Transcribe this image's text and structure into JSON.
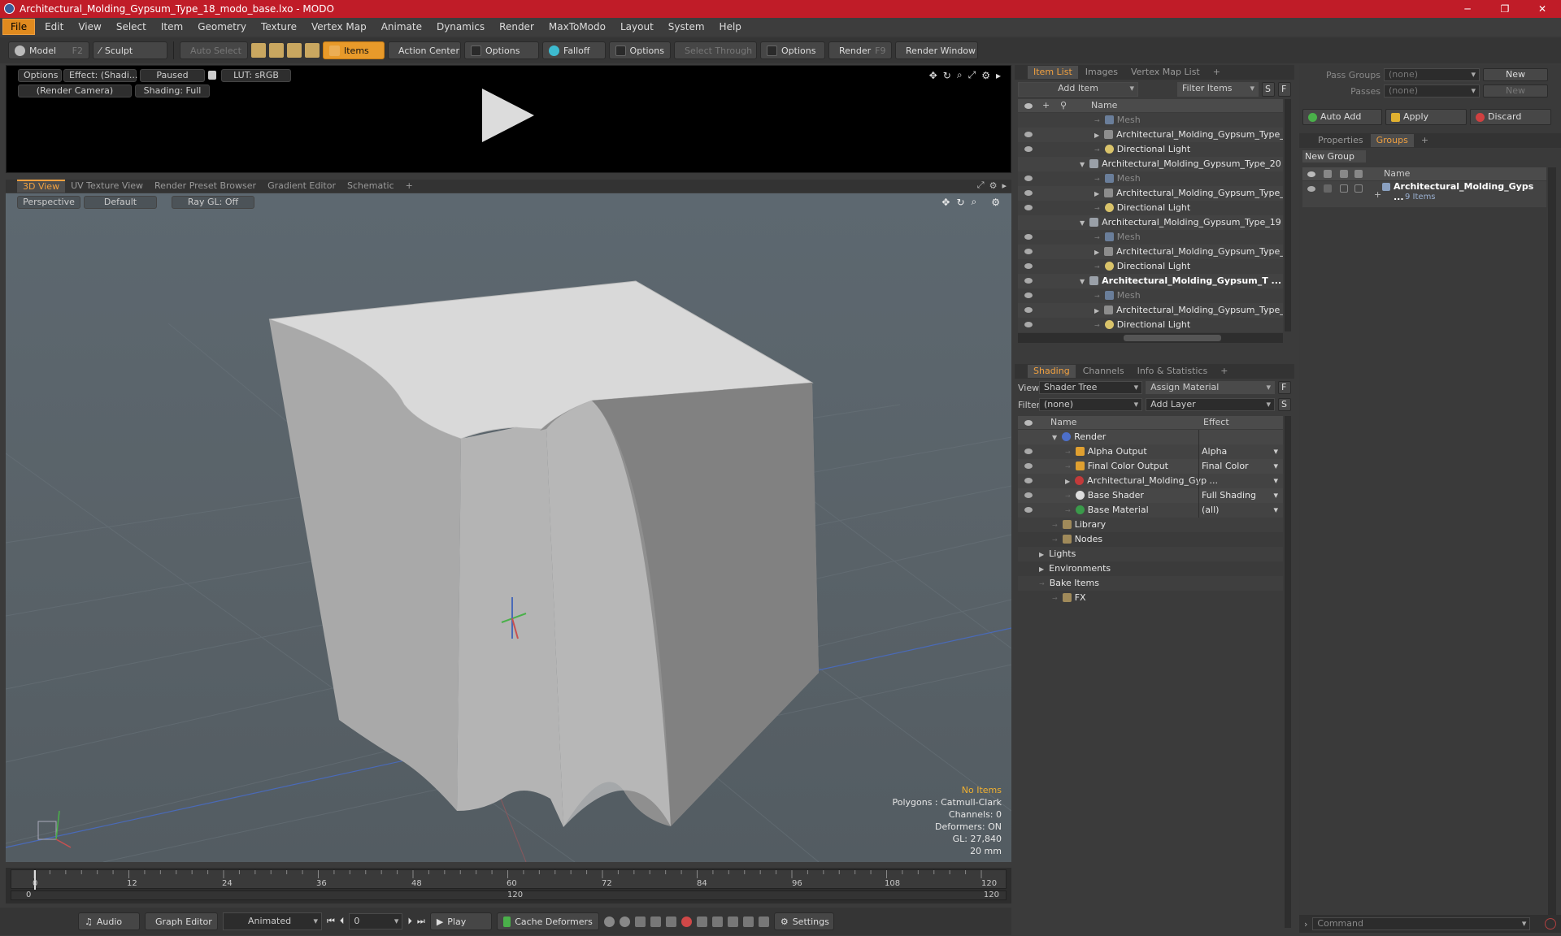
{
  "window": {
    "title": "Architectural_Molding_Gypsum_Type_18_modo_base.lxo - MODO",
    "min": "─",
    "max": "❐",
    "close": "✕"
  },
  "menu": [
    "File",
    "Edit",
    "View",
    "Select",
    "Item",
    "Geometry",
    "Texture",
    "Vertex Map",
    "Animate",
    "Dynamics",
    "Render",
    "MaxToModo",
    "Layout",
    "System",
    "Help"
  ],
  "toolbar": {
    "model": "Model",
    "model_key": "F2",
    "sculpt": "Sculpt",
    "auto_select": "Auto Select",
    "items": "Items",
    "action_center": "Action Center",
    "options1": "Options",
    "falloff": "Falloff",
    "options2": "Options",
    "select_through": "Select Through",
    "options3": "Options",
    "render": "Render",
    "render_key": "F9",
    "render_window": "Render Window"
  },
  "preview": {
    "options": "Options",
    "effect": "Effect: (Shadi...",
    "paused": "Paused",
    "lut": "LUT: sRGB",
    "camera": "(Render Camera)",
    "shading": "Shading: Full"
  },
  "view_tabs": [
    "3D View",
    "UV Texture View",
    "Render Preset Browser",
    "Gradient Editor",
    "Schematic",
    "+"
  ],
  "viewport": {
    "perspective": "Perspective",
    "default": "Default",
    "raygl": "Ray GL: Off",
    "hud": {
      "no_items": "No Items",
      "polygons": "Polygons : Catmull-Clark",
      "channels": "Channels: 0",
      "deformers": "Deformers: ON",
      "gl": "GL: 27,840",
      "unit": "20 mm"
    }
  },
  "timeline": {
    "ticks": [
      "0",
      "12",
      "24",
      "36",
      "48",
      "60",
      "72",
      "84",
      "96",
      "108",
      "120"
    ],
    "start": "0",
    "mid": "120",
    "end": "120"
  },
  "bottombar": {
    "audio": "Audio",
    "graph_editor": "Graph Editor",
    "animated": "Animated",
    "frame": "0",
    "play": "Play",
    "cache": "Cache Deformers",
    "settings": "Settings"
  },
  "itemlist": {
    "tabs": [
      "Item List",
      "Images",
      "Vertex Map List",
      "+"
    ],
    "add_item": "Add Item",
    "filter_items": "Filter Items",
    "s": "S",
    "f": "F",
    "name_col": "Name",
    "rows": [
      {
        "label": "Mesh",
        "indent": 3,
        "icon": "mesh",
        "style": "dim",
        "eye": false
      },
      {
        "label": "Architectural_Molding_Gypsum_Type_ ...",
        "indent": 3,
        "icon": "grp",
        "style": "",
        "eye": true,
        "arrow": "▶"
      },
      {
        "label": "Directional Light",
        "indent": 3,
        "icon": "light",
        "style": "",
        "eye": true
      },
      {
        "label": "Architectural_Molding_Gypsum_Type_20 ...",
        "indent": 2,
        "icon": "scene",
        "style": "",
        "eye": false,
        "arrow": "▼"
      },
      {
        "label": "Mesh",
        "indent": 3,
        "icon": "mesh",
        "style": "dim",
        "eye": true
      },
      {
        "label": "Architectural_Molding_Gypsum_Type_ ...",
        "indent": 3,
        "icon": "grp",
        "style": "",
        "eye": true,
        "arrow": "▶"
      },
      {
        "label": "Directional Light",
        "indent": 3,
        "icon": "light",
        "style": "",
        "eye": true
      },
      {
        "label": "Architectural_Molding_Gypsum_Type_19 ...",
        "indent": 2,
        "icon": "scene",
        "style": "",
        "eye": false,
        "arrow": "▼"
      },
      {
        "label": "Mesh",
        "indent": 3,
        "icon": "mesh",
        "style": "dim",
        "eye": true
      },
      {
        "label": "Architectural_Molding_Gypsum_Type_ ...",
        "indent": 3,
        "icon": "grp",
        "style": "",
        "eye": true,
        "arrow": "▶"
      },
      {
        "label": "Directional Light",
        "indent": 3,
        "icon": "light",
        "style": "",
        "eye": true
      },
      {
        "label": "Architectural_Molding_Gypsum_T ...",
        "indent": 2,
        "icon": "scene",
        "style": "bold",
        "eye": true,
        "arrow": "▼"
      },
      {
        "label": "Mesh",
        "indent": 3,
        "icon": "mesh",
        "style": "dim",
        "eye": true
      },
      {
        "label": "Architectural_Molding_Gypsum_Type_ ...",
        "indent": 3,
        "icon": "grp",
        "style": "",
        "eye": true,
        "arrow": "▶"
      },
      {
        "label": "Directional Light",
        "indent": 3,
        "icon": "light",
        "style": "",
        "eye": true
      }
    ]
  },
  "shading": {
    "tabs": [
      "Shading",
      "Channels",
      "Info & Statistics",
      "+"
    ],
    "view_label": "View",
    "view_value": "Shader Tree",
    "assign_material": "Assign Material",
    "f": "F",
    "filter_label": "Filter",
    "filter_value": "(none)",
    "add_layer": "Add Layer",
    "s": "S",
    "name_col": "Name",
    "effect_col": "Effect",
    "rows": [
      {
        "label": "Render",
        "indent": 1,
        "icon": "render",
        "effect": "",
        "eye": false,
        "arrow": "▼"
      },
      {
        "label": "Alpha Output",
        "indent": 2,
        "icon": "out",
        "effect": "Alpha",
        "eye": true
      },
      {
        "label": "Final Color Output",
        "indent": 2,
        "icon": "out",
        "effect": "Final Color",
        "eye": true
      },
      {
        "label": "Architectural_Molding_Gyp ...",
        "indent": 2,
        "icon": "mat",
        "effect": "",
        "eye": true,
        "arrow": "▶"
      },
      {
        "label": "Base Shader",
        "indent": 2,
        "icon": "shader",
        "effect": "Full Shading",
        "eye": true
      },
      {
        "label": "Base Material",
        "indent": 2,
        "icon": "basem",
        "effect": "(all)",
        "eye": true
      },
      {
        "label": "Library",
        "indent": 1,
        "icon": "fold",
        "effect": "",
        "eye": false
      },
      {
        "label": "Nodes",
        "indent": 1,
        "icon": "fold",
        "effect": "",
        "eye": false
      },
      {
        "label": "Lights",
        "indent": 0,
        "icon": "",
        "effect": "",
        "eye": false,
        "arrow": "▶"
      },
      {
        "label": "Environments",
        "indent": 0,
        "icon": "",
        "effect": "",
        "eye": false,
        "arrow": "▶"
      },
      {
        "label": "Bake Items",
        "indent": 0,
        "icon": "",
        "effect": "",
        "eye": false
      },
      {
        "label": "FX",
        "indent": 1,
        "icon": "fold",
        "effect": "",
        "eye": false
      }
    ]
  },
  "groups": {
    "pass_groups_label": "Pass Groups",
    "pass_groups_value": "(none)",
    "new1": "New",
    "passes_label": "Passes",
    "passes_value": "(none)",
    "new2": "New",
    "auto_add": "Auto Add",
    "apply": "Apply",
    "discard": "Discard",
    "tabs": [
      "Properties",
      "Groups",
      "+"
    ],
    "new_group": "New Group",
    "name_col": "Name",
    "item_name": "Architectural_Molding_Gyps ...",
    "item_count": "9 Items",
    "command": "Command"
  },
  "colors": {
    "accent": "#f0a040",
    "titlebar": "#c01c28"
  }
}
